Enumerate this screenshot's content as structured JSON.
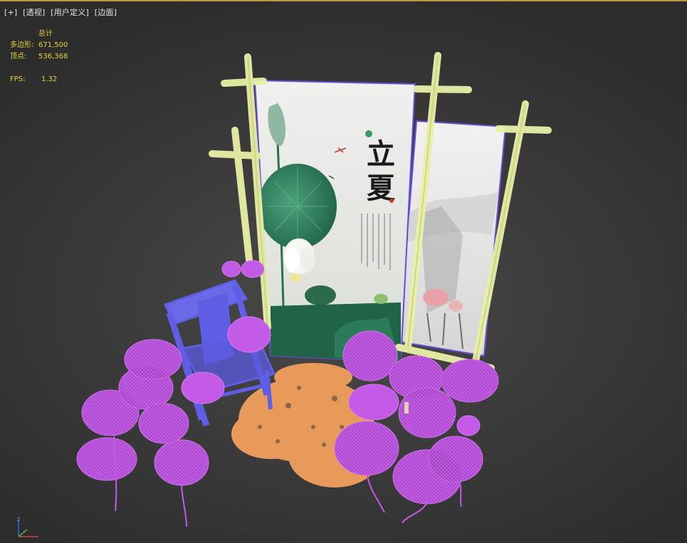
{
  "menu": {
    "plus": "[+]",
    "perspective": "[透视]",
    "user_defined": "[用户定义]",
    "edged_faces": "[边面]"
  },
  "stats": {
    "total_label": "总计",
    "polygons_label": "多边形:",
    "polygons_value": "671,500",
    "vertices_label": "顶点:",
    "vertices_value": "536,368",
    "fps_label": "FPS:",
    "fps_value": "1.32"
  },
  "poster": {
    "title_top": "立",
    "title_bottom": "夏"
  },
  "gizmo": {
    "z": "z"
  },
  "colors": {
    "stats_text": "#e8d23a",
    "bamboo": "#e9f0a6",
    "lotus_leaf": "#c35be6",
    "petals": "#e89a5a",
    "chair": "#5f5ee4",
    "viewport_bg": "#3c3c3c"
  }
}
